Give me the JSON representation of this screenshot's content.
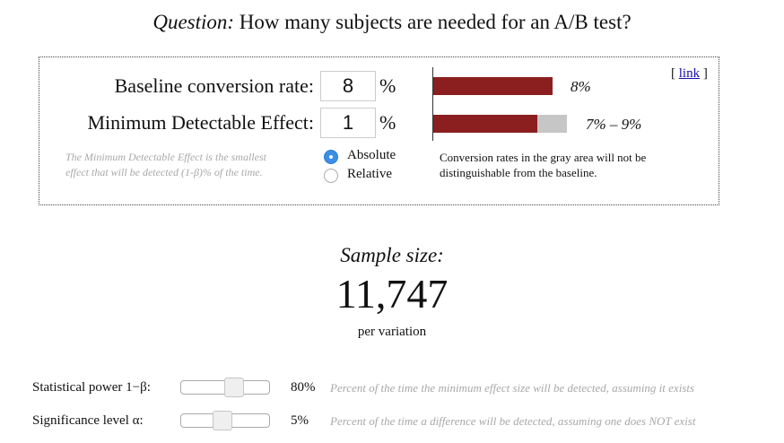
{
  "title": {
    "question_label": "Question:",
    "question_text": "How many subjects are needed for an A/B test?"
  },
  "inputs": {
    "baseline_label": "Baseline conversion rate:",
    "baseline_value": "8",
    "baseline_unit": "%",
    "mde_label": "Minimum Detectable Effect:",
    "mde_value": "1",
    "mde_unit": "%",
    "mde_note_line1": "The Minimum Detectable Effect is the smallest",
    "mde_note_line2": "effect that will be detected (1-β)% of the time.",
    "mode_options": [
      "Absolute",
      "Relative"
    ],
    "mode_selected": "Absolute"
  },
  "visual": {
    "baseline_label": "8%",
    "range_label": "7% – 9%",
    "baseline_fraction": 0.8,
    "range_fill_fraction": 0.7,
    "range_gray_fraction": 0.9,
    "link_open": "[",
    "link_text": "link",
    "link_close": "]",
    "conversion_note": "Conversion rates in the gray area will not be distinguishable from the baseline.",
    "bar_color": "#8b1f1f",
    "gray_color": "#c6c6c6"
  },
  "result": {
    "label": "Sample size:",
    "value": "11,747",
    "sub": "per variation"
  },
  "settings": {
    "power_label": "Statistical power 1−β:",
    "power_value": "80%",
    "power_level": 0.8,
    "power_desc": "Percent of the time the minimum effect size will be detected, assuming it exists",
    "sig_label": "Significance level α:",
    "sig_value": "5%",
    "sig_level": 0.05,
    "sig_desc": "Percent of the time a difference will be detected, assuming one does NOT exist"
  }
}
